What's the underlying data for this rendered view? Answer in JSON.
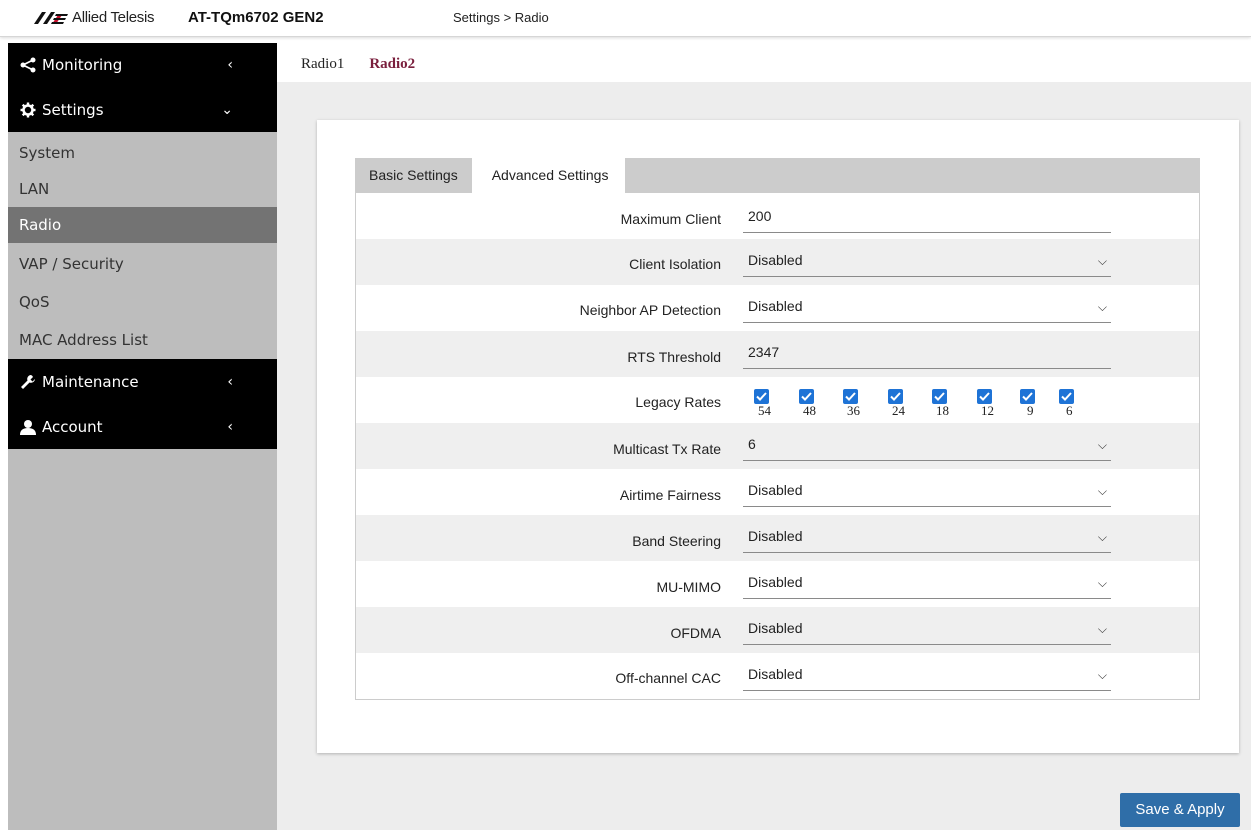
{
  "header": {
    "brand": "Allied Telesis",
    "model": "AT-TQm6702 GEN2",
    "breadcrumb": "Settings > Radio",
    "brand_color": "#7a1f3d"
  },
  "sidebar": {
    "monitoring": {
      "label": "Monitoring",
      "icon": "share-icon"
    },
    "settings": {
      "label": "Settings",
      "icon": "gear-icon"
    },
    "items": [
      {
        "label": "System"
      },
      {
        "label": "LAN"
      },
      {
        "label": "Radio",
        "active": true
      },
      {
        "label": "VAP / Security"
      },
      {
        "label": "QoS"
      },
      {
        "label": "MAC Address List"
      }
    ],
    "maintenance": {
      "label": "Maintenance",
      "icon": "wrench-icon"
    },
    "account": {
      "label": "Account",
      "icon": "user-icon"
    }
  },
  "radio_tabs": [
    {
      "label": "Radio1"
    },
    {
      "label": "Radio2",
      "active": true
    }
  ],
  "settings_tabs": [
    {
      "label": "Basic Settings"
    },
    {
      "label": "Advanced Settings",
      "active": true
    }
  ],
  "form": {
    "max_client": {
      "label": "Maximum Client",
      "value": "200"
    },
    "client_isolation": {
      "label": "Client Isolation",
      "value": "Disabled"
    },
    "neighbor_ap": {
      "label": "Neighbor AP Detection",
      "value": "Disabled"
    },
    "rts_threshold": {
      "label": "RTS Threshold",
      "value": "2347"
    },
    "legacy_rates": {
      "label": "Legacy Rates",
      "rates": [
        "54",
        "48",
        "36",
        "24",
        "18",
        "12",
        "9",
        "6"
      ],
      "checked": true
    },
    "multicast_tx": {
      "label": "Multicast Tx Rate",
      "value": "6"
    },
    "airtime_fairness": {
      "label": "Airtime Fairness",
      "value": "Disabled"
    },
    "band_steering": {
      "label": "Band Steering",
      "value": "Disabled"
    },
    "mu_mimo": {
      "label": "MU-MIMO",
      "value": "Disabled"
    },
    "ofdma": {
      "label": "OFDMA",
      "value": "Disabled"
    },
    "off_channel_cac": {
      "label": "Off-channel CAC",
      "value": "Disabled"
    }
  },
  "actions": {
    "save_label": "Save & Apply"
  },
  "colors": {
    "accent": "#2f6ea8",
    "checkbox": "#1e73d6",
    "sidebar_active": "#737373"
  }
}
